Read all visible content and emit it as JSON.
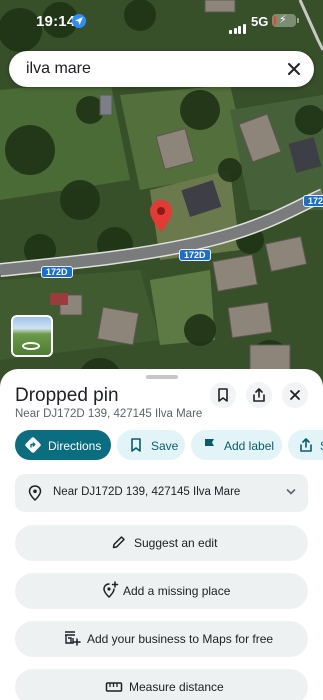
{
  "status_bar": {
    "time": "19:14",
    "network": "5G",
    "battery_percent": 8,
    "icons": [
      "location-arrow-icon",
      "signal-icon",
      "battery-charging-icon"
    ]
  },
  "search": {
    "value": "ilva mare",
    "clear_icon": "close-icon"
  },
  "map": {
    "road_labels": [
      "172D",
      "172D",
      "172D"
    ],
    "pin_color": "#e53935",
    "thumbnail_icon": "street-view-icon"
  },
  "place": {
    "title": "Dropped pin",
    "subtitle": "Near DJ172D 139, 427145 Ilva Mare",
    "header_icons": [
      "bookmark-icon",
      "share-icon",
      "close-icon"
    ]
  },
  "chips": [
    {
      "label": "Directions",
      "icon": "directions-icon"
    },
    {
      "label": "Save",
      "icon": "bookmark-icon"
    },
    {
      "label": "Add label",
      "icon": "flag-icon"
    },
    {
      "label": "S",
      "icon": "share-icon"
    }
  ],
  "address_row": {
    "text": "Near DJ172D 139, 427145 Ilva Mare",
    "icon": "location-pin-icon",
    "toggle_icon": "chevron-down-icon"
  },
  "actions": [
    {
      "label": "Suggest an edit",
      "icon": "pencil-icon"
    },
    {
      "label": "Add a missing place",
      "icon": "add-place-icon"
    },
    {
      "label": "Add your business to Maps for free",
      "icon": "add-business-icon"
    },
    {
      "label": "Measure distance",
      "icon": "ruler-icon"
    }
  ],
  "colors": {
    "accent": "#0b6d80",
    "chip_bg": "#e3f4f8",
    "row_bg": "#eef1f2",
    "battery": "#ff3b30"
  }
}
